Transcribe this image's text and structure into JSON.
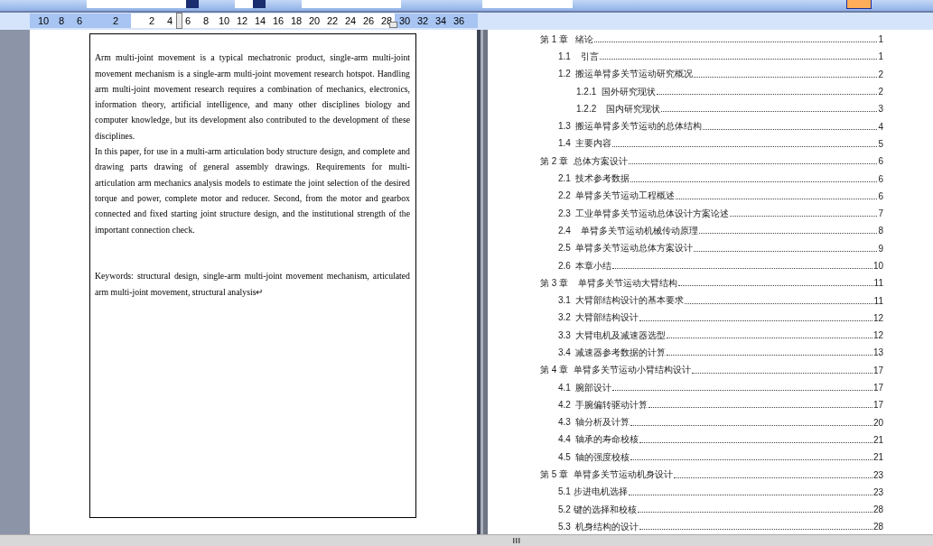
{
  "ruler": {
    "marks": [
      {
        "kind": "number",
        "label": "10"
      },
      {
        "kind": "number",
        "label": "8"
      },
      {
        "kind": "number",
        "label": "6"
      },
      {
        "kind": "gap"
      },
      {
        "kind": "number",
        "label": "2"
      },
      {
        "kind": "gap"
      },
      {
        "kind": "number",
        "label": "2"
      },
      {
        "kind": "number",
        "label": "4"
      },
      {
        "kind": "number",
        "label": "6"
      },
      {
        "kind": "number",
        "label": "8"
      },
      {
        "kind": "number",
        "label": "10"
      },
      {
        "kind": "number",
        "label": "12"
      },
      {
        "kind": "number",
        "label": "14"
      },
      {
        "kind": "number",
        "label": "16"
      },
      {
        "kind": "number",
        "label": "18"
      },
      {
        "kind": "number",
        "label": "20"
      },
      {
        "kind": "number",
        "label": "22"
      },
      {
        "kind": "number",
        "label": "24"
      },
      {
        "kind": "number",
        "label": "26"
      },
      {
        "kind": "number",
        "label": "28"
      },
      {
        "kind": "number",
        "label": "30"
      },
      {
        "kind": "number",
        "label": "32"
      },
      {
        "kind": "number",
        "label": "34"
      },
      {
        "kind": "number",
        "label": "36"
      }
    ]
  },
  "left_page": {
    "paragraphs": [
      {
        "kind": "blank"
      },
      {
        "kind": "text",
        "text": "Arm multi-joint movement is a typical mechatronic product, single-arm multi-joint movement mechanism is a single-arm multi-joint movement research hotspot. Handling arm multi-joint movement research requires a combination of mechanics, electronics, information theory, artificial intelligence, and many other disciplines biology and computer knowledge, but its development also contributed to the development of these disciplines."
      },
      {
        "kind": "text",
        "text": "In this paper, for use in a multi-arm articulation body structure design, and complete and drawing parts drawing of general assembly drawings. Requirements for multi-articulation arm mechanics analysis models to estimate the joint selection of the desired torque and power, complete motor and reducer. Second, from the motor and gearbox connected and fixed starting joint structure design, and the institutional strength of the important connection check."
      },
      {
        "kind": "blank"
      },
      {
        "kind": "blank"
      },
      {
        "kind": "text",
        "text": "Keywords: structural design, single-arm multi-joint movement mechanism, articulated arm multi-joint movement, structural analysis↵"
      }
    ]
  },
  "toc": [
    {
      "title": "第 1 章   绪论",
      "page": "1",
      "children": [
        {
          "title": "1.1    引言",
          "page": "1"
        },
        {
          "title": "1.2  搬运单臂多关节运动研究概况",
          "page": "2",
          "children": [
            {
              "title": "1.2.1  国外研究现状",
              "page": "2"
            },
            {
              "title": "1.2.2    国内研究现状",
              "page": "3"
            }
          ]
        },
        {
          "title": "1.3  搬运单臂多关节运动的总体结构",
          "page": "4"
        },
        {
          "title": "1.4  主要内容",
          "page": "5"
        }
      ]
    },
    {
      "title": "第 2 章  总体方案设计",
      "page": "6",
      "children": [
        {
          "title": "2.1  技术参考数据",
          "page": "6"
        },
        {
          "title": "2.2  单臂多关节运动工程概述",
          "page": "6"
        },
        {
          "title": "2.3  工业单臂多关节运动总体设计方案论述",
          "page": "7"
        },
        {
          "title": "2.4    单臂多关节运动机械传动原理",
          "page": "8"
        },
        {
          "title": "2.5  单臂多关节运动总体方案设计",
          "page": "9"
        },
        {
          "title": "2.6  本章小结",
          "page": "10"
        }
      ]
    },
    {
      "title": "第 3 章    单臂多关节运动大臂结构",
      "page": "11",
      "children": [
        {
          "title": "3.1  大臂部结构设计的基本要求",
          "page": "11"
        },
        {
          "title": "3.2  大臂部结构设计",
          "page": "12"
        },
        {
          "title": "3.3  大臂电机及减速器选型",
          "page": "12"
        },
        {
          "title": "3.4  减速器参考数据的计算",
          "page": "13"
        }
      ]
    },
    {
      "title": "第 4 章  单臂多关节运动小臂结构设计",
      "page": "17",
      "children": [
        {
          "title": "4.1  腕部设计",
          "page": "17"
        },
        {
          "title": "4.2  手腕偏转驱动计算",
          "page": "17"
        },
        {
          "title": "4.3  轴分析及计算",
          "page": "20"
        },
        {
          "title": "4.4  轴承的寿命校核",
          "page": "21"
        },
        {
          "title": "4.5  轴的强度校核",
          "page": "21"
        }
      ]
    },
    {
      "title": "第 5 章  单臂多关节运动机身设计",
      "page": "23",
      "children": [
        {
          "title": "5.1 步进电机选择",
          "page": "23"
        },
        {
          "title": "5.2 键的选择和校核",
          "page": "28"
        },
        {
          "title": "5.3  机身结构的设计",
          "page": "28"
        }
      ]
    }
  ]
}
